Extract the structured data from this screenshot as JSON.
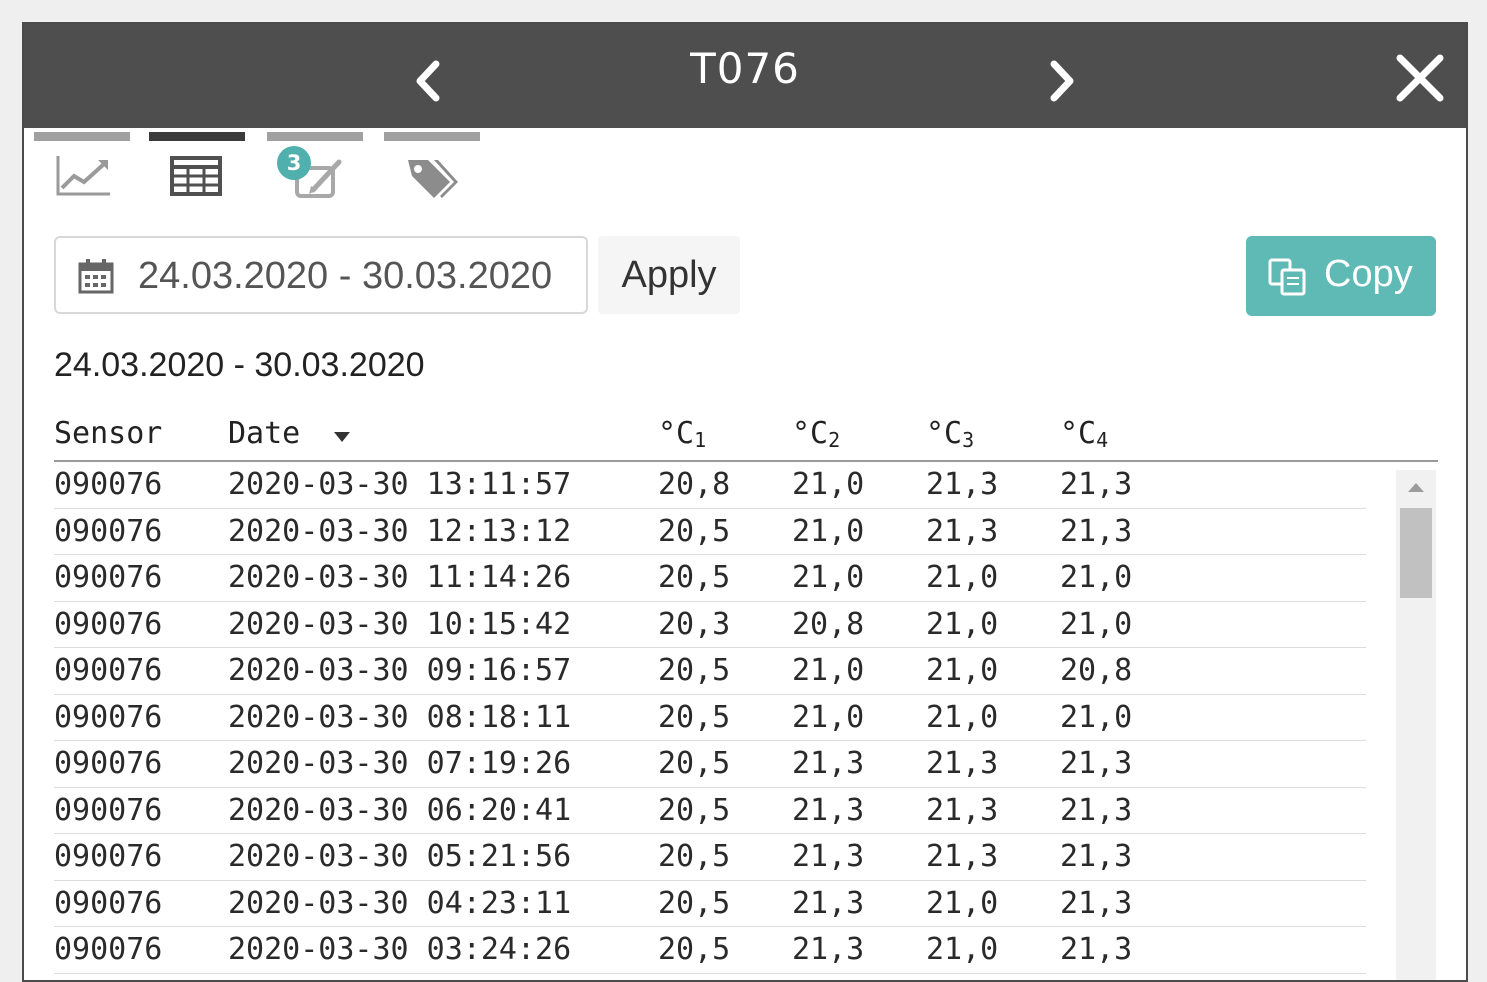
{
  "header": {
    "title": "T076"
  },
  "tabs": [
    {
      "icon": "line-chart-icon",
      "active": false
    },
    {
      "icon": "table-icon",
      "active": true
    },
    {
      "icon": "notes-icon",
      "active": false,
      "badge": "3"
    },
    {
      "icon": "tags-icon",
      "active": false
    }
  ],
  "toolbar": {
    "date_range_value": "24.03.2020 - 30.03.2020",
    "apply_label": "Apply",
    "copy_label": "Copy"
  },
  "range_heading": "24.03.2020 - 30.03.2020",
  "table": {
    "headers": {
      "sensor": "Sensor",
      "date": "Date",
      "t1": "°C",
      "t1_sub": "1",
      "t2": "°C",
      "t2_sub": "2",
      "t3": "°C",
      "t3_sub": "3",
      "t4": "°C",
      "t4_sub": "4"
    },
    "sort": {
      "column": "Date",
      "direction": "descending"
    },
    "rows": [
      [
        "090076",
        "2020-03-30 13:11:57",
        "20,8",
        "21,0",
        "21,3",
        "21,3"
      ],
      [
        "090076",
        "2020-03-30 12:13:12",
        "20,5",
        "21,0",
        "21,3",
        "21,3"
      ],
      [
        "090076",
        "2020-03-30 11:14:26",
        "20,5",
        "21,0",
        "21,0",
        "21,0"
      ],
      [
        "090076",
        "2020-03-30 10:15:42",
        "20,3",
        "20,8",
        "21,0",
        "21,0"
      ],
      [
        "090076",
        "2020-03-30 09:16:57",
        "20,5",
        "21,0",
        "21,0",
        "20,8"
      ],
      [
        "090076",
        "2020-03-30 08:18:11",
        "20,5",
        "21,0",
        "21,0",
        "21,0"
      ],
      [
        "090076",
        "2020-03-30 07:19:26",
        "20,5",
        "21,3",
        "21,3",
        "21,3"
      ],
      [
        "090076",
        "2020-03-30 06:20:41",
        "20,5",
        "21,3",
        "21,3",
        "21,3"
      ],
      [
        "090076",
        "2020-03-30 05:21:56",
        "20,5",
        "21,3",
        "21,3",
        "21,3"
      ],
      [
        "090076",
        "2020-03-30 04:23:11",
        "20,5",
        "21,3",
        "21,0",
        "21,3"
      ],
      [
        "090076",
        "2020-03-30 03:24:26",
        "20,5",
        "21,3",
        "21,0",
        "21,3"
      ]
    ]
  },
  "colors": {
    "header_bg": "#4e4e4e",
    "copy_button": "#5fb9b4",
    "badge": "#4fb0ad",
    "tab_active": "#3b3b3b",
    "tab_inactive": "#a0a0a0"
  }
}
